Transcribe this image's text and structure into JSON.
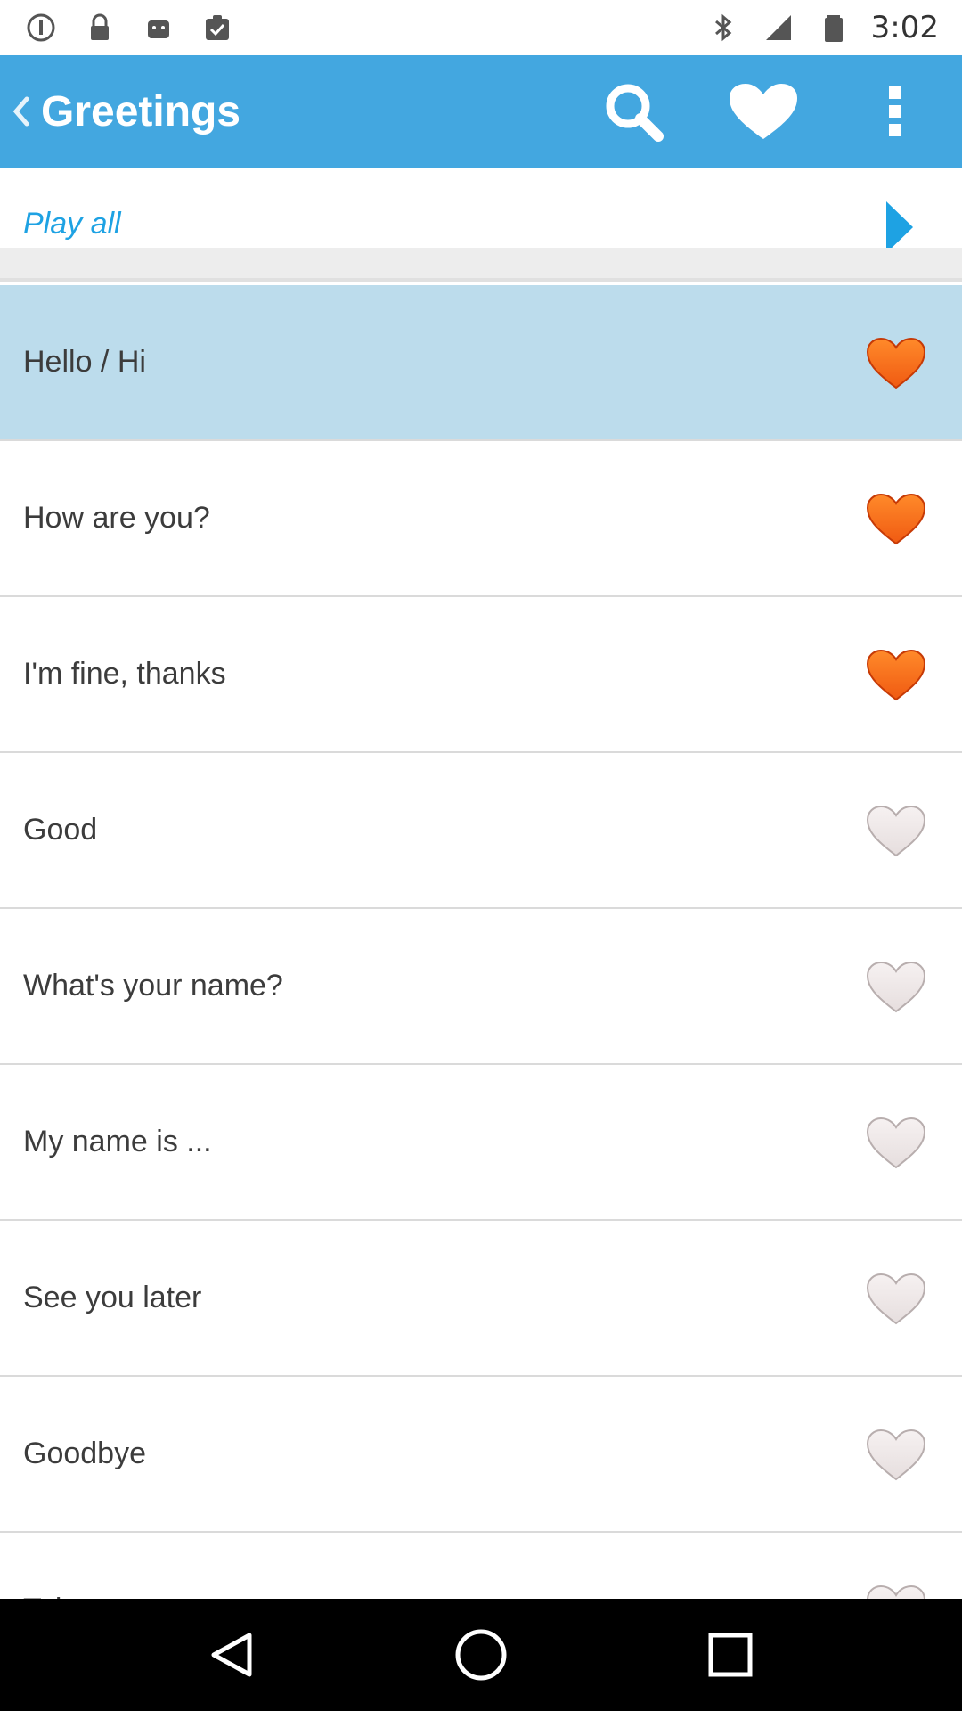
{
  "status_bar": {
    "time": "3:02",
    "icons": [
      "sim-icon",
      "lock-icon",
      "android-icon",
      "clipboard-check-icon",
      "bluetooth-icon",
      "signal-icon",
      "battery-icon"
    ]
  },
  "app_bar": {
    "title": "Greetings",
    "actions": [
      "search-icon",
      "heart-icon",
      "overflow-menu-icon"
    ]
  },
  "play_all": {
    "label": "Play all"
  },
  "phrases": [
    {
      "text": "Hello / Hi",
      "favorite": true,
      "selected": true
    },
    {
      "text": "How are you?",
      "favorite": true,
      "selected": false
    },
    {
      "text": "I'm fine, thanks",
      "favorite": true,
      "selected": false
    },
    {
      "text": "Good",
      "favorite": false,
      "selected": false
    },
    {
      "text": "What's your name?",
      "favorite": false,
      "selected": false
    },
    {
      "text": "My name is ...",
      "favorite": false,
      "selected": false
    },
    {
      "text": "See you later",
      "favorite": false,
      "selected": false
    },
    {
      "text": "Goodbye",
      "favorite": false,
      "selected": false
    },
    {
      "text": "Take care",
      "favorite": false,
      "selected": false
    }
  ],
  "colors": {
    "app_bar": "#43a7e0",
    "accent": "#1ea2e3",
    "selected_row": "#bcdcec",
    "heart_active": "#f05a12",
    "heart_inactive": "#e6dede"
  },
  "nav_bar": {
    "buttons": [
      "back-icon",
      "home-icon",
      "recents-icon"
    ]
  }
}
